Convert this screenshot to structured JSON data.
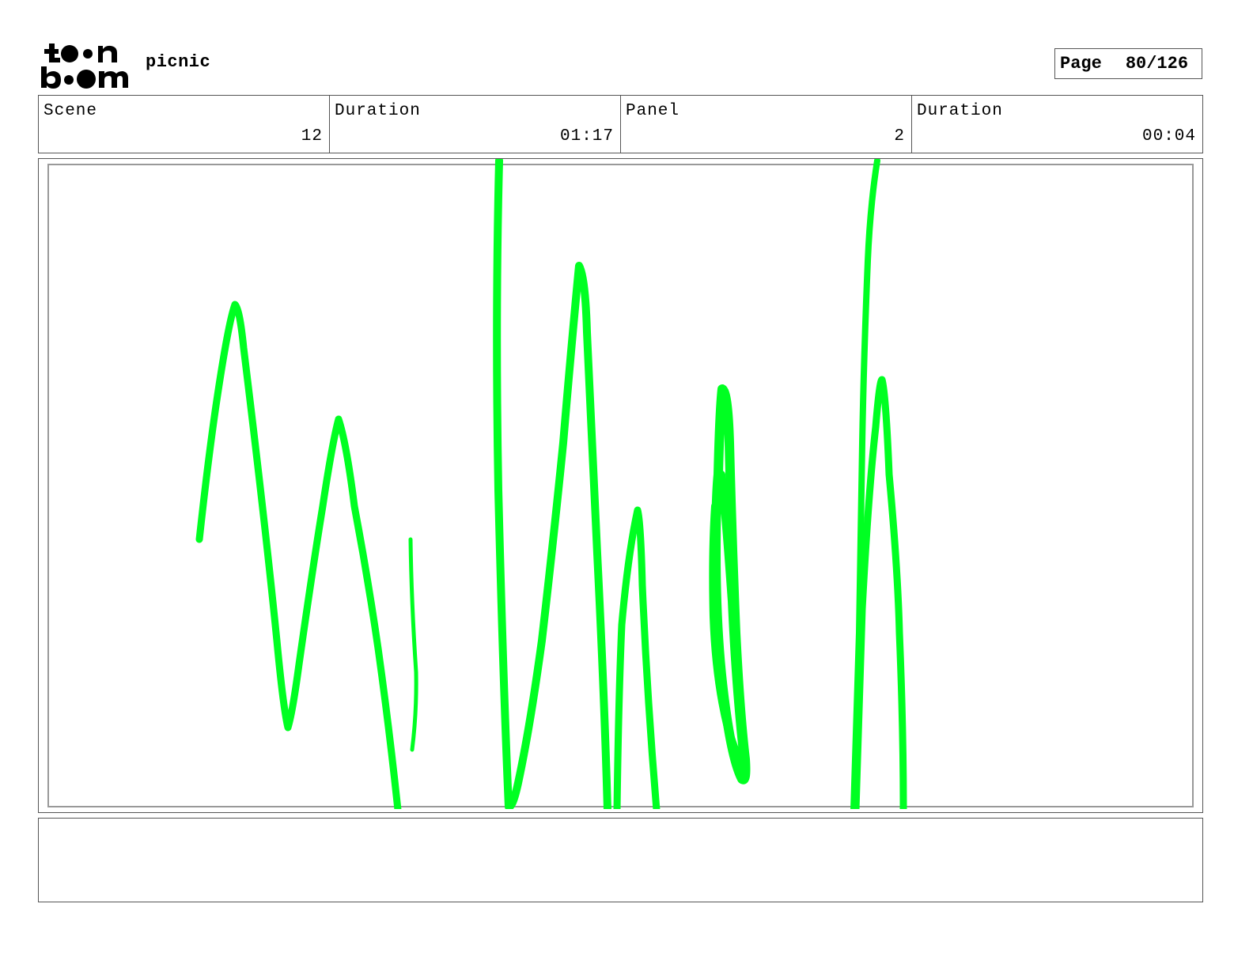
{
  "header": {
    "logo_text": "toon boom",
    "project_title": "picnic",
    "page_label": "Page",
    "page_value": "80/126"
  },
  "info": {
    "scene_label": "Scene",
    "scene_value": "12",
    "scene_duration_label": "Duration",
    "scene_duration_value": "01:17",
    "panel_label": "Panel",
    "panel_value": "2",
    "panel_duration_label": "Duration",
    "panel_duration_value": "00:04"
  },
  "drawing": {
    "stroke_color": "#00ff22",
    "description_icon": "green-scribble-strokes"
  },
  "notes": {
    "text": ""
  }
}
